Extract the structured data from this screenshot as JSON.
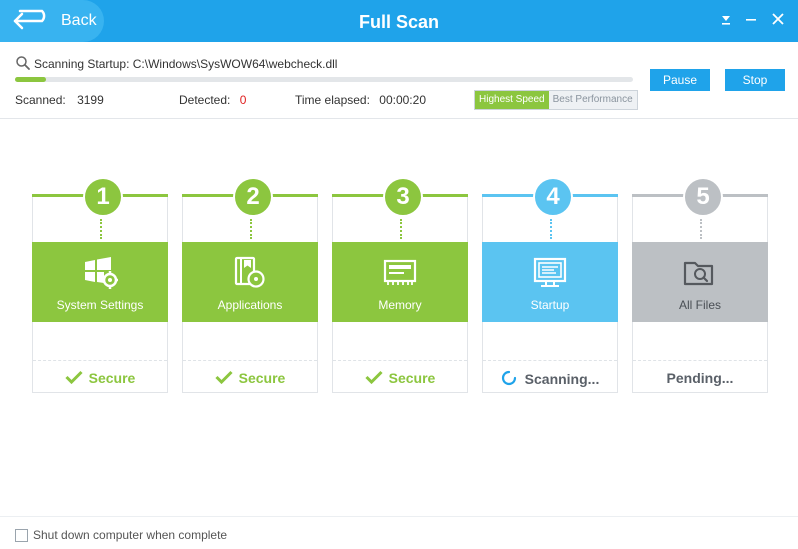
{
  "header": {
    "back_label": "Back",
    "title": "Full Scan",
    "controls": [
      "chevron-down-icon",
      "minimize-icon",
      "close-icon"
    ]
  },
  "scan": {
    "current_label": "Scanning Startup:",
    "current_path": "C:\\Windows\\SysWOW64\\webcheck.dll",
    "progress_fraction": 0.05,
    "scanned_label": "Scanned:",
    "scanned_value": "3199",
    "detected_label": "Detected:",
    "detected_value": "0",
    "elapsed_label": "Time elapsed:",
    "elapsed_value": "00:00:20",
    "speed_options": [
      "Highest Speed",
      "Best Performance"
    ],
    "speed_selected": "Highest Speed",
    "pause_label": "Pause",
    "stop_label": "Stop"
  },
  "steps": [
    {
      "number": "1",
      "label": "System Settings",
      "icon": "windows-gear-icon",
      "status": "Secure",
      "state": "done",
      "color": "#8cc63f"
    },
    {
      "number": "2",
      "label": "Applications",
      "icon": "applications-icon",
      "status": "Secure",
      "state": "done",
      "color": "#8cc63f"
    },
    {
      "number": "3",
      "label": "Memory",
      "icon": "memory-icon",
      "status": "Secure",
      "state": "done",
      "color": "#8cc63f"
    },
    {
      "number": "4",
      "label": "Startup",
      "icon": "startup-icon",
      "status": "Scanning...",
      "state": "active",
      "color": "#5bc4f1"
    },
    {
      "number": "5",
      "label": "All Files",
      "icon": "folder-search-icon",
      "status": "Pending...",
      "state": "pending",
      "color": "#bcc0c4"
    }
  ],
  "colors": {
    "accent_blue": "#1fa3ea",
    "secure_green": "#8cc63f",
    "pending_gray": "#bcc0c4",
    "detected_red": "#e02020"
  },
  "footer": {
    "shutdown_label": "Shut down computer when complete",
    "shutdown_checked": false
  }
}
